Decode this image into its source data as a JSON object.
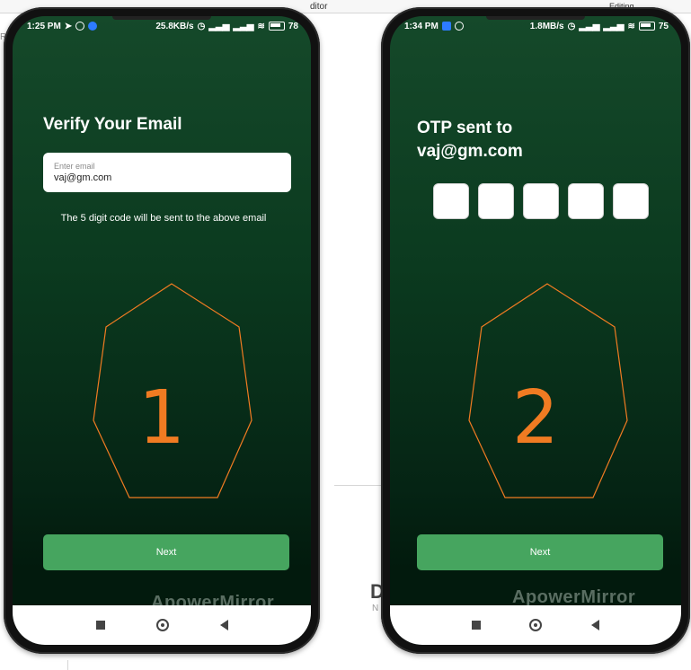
{
  "background": {
    "editor_tab_text": "ditor",
    "editing_text": "Editing",
    "left_fragment": "R",
    "mid_fragments": [
      "D",
      "N"
    ]
  },
  "phone1": {
    "status": {
      "time": "1:25 PM",
      "speed": "25.8KB/s",
      "battery": "78"
    },
    "title": "Verify Your Email",
    "email_input": {
      "label": "Enter email",
      "value": "vaj@gm.com"
    },
    "hint": "The 5 digit code will be sent to the above email",
    "step_number": "1",
    "next_button": "Next",
    "watermark": "ApowerMirror"
  },
  "phone2": {
    "status": {
      "time": "1:34 PM",
      "speed": "1.8MB/s",
      "battery": "75"
    },
    "title_line1": "OTP sent to",
    "title_line2": "vaj@gm.com",
    "otp_boxes": [
      "",
      "",
      "",
      "",
      ""
    ],
    "step_number": "2",
    "next_button": "Next",
    "watermark": "ApowerMirror"
  },
  "colors": {
    "accent_orange": "#f07b22",
    "button_green": "#46a55f",
    "screen_green_top": "#15492a",
    "screen_green_bottom": "#021a0d"
  }
}
